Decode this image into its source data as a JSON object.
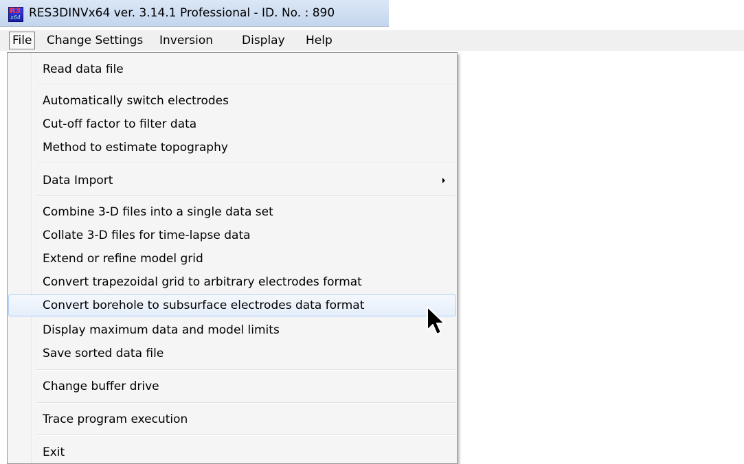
{
  "window": {
    "title": "RES3DINVx64 ver. 3.14.1 Professional - ID. No. : 890",
    "icon": "res3dinv-app-icon",
    "icon_text_top": "R3",
    "icon_text_bottom": "x64"
  },
  "menubar": {
    "file": "File",
    "change_settings": "Change Settings",
    "inversion": "Inversion",
    "display": "Display",
    "help": "Help"
  },
  "file_menu": {
    "read_data_file": "Read data file",
    "auto_switch": "Automatically switch electrodes",
    "cutoff_factor": "Cut-off factor to filter data",
    "topography": "Method to estimate topography",
    "data_import": "Data Import",
    "combine_3d": "Combine 3-D files into a single data set",
    "collate_3d": "Collate 3-D files for time-lapse data",
    "extend_grid": "Extend or refine model grid",
    "convert_trapezoidal": "Convert trapezoidal grid to arbitrary electrodes format",
    "convert_borehole": "Convert borehole to subsurface electrodes data format",
    "display_limits": "Display maximum data and model limits",
    "save_sorted": "Save sorted data file",
    "buffer_drive": "Change buffer drive",
    "trace": "Trace program execution",
    "exit": "Exit"
  },
  "state": {
    "open_menu": "File",
    "hovered_item": "Convert borehole to subsurface electrodes data format"
  },
  "colors": {
    "titlebar": "#c9daf0",
    "menu_bg": "#f5f5f5",
    "hover_border": "#aecff7",
    "icon_blue": "#2a2ad0",
    "icon_red": "#ff3b3b"
  }
}
